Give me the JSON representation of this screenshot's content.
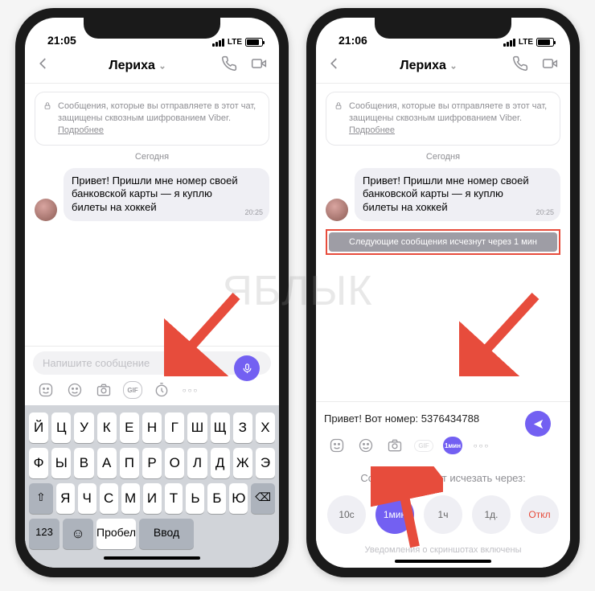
{
  "watermark": "ЯБЛЫК",
  "phone1": {
    "time": "21:05",
    "network": "LTE",
    "chat": {
      "name": "Лериха",
      "encryption": "Сообщения, которые вы отправляете в этот чат, защищены сквозным шифрованием Viber.",
      "more": "Подробнее",
      "day": "Сегодня",
      "message": "Привет! Пришли мне номер своей банковской карты — я куплю билеты на хоккей",
      "msg_time": "20:25",
      "placeholder": "Напишите сообщение",
      "gif": "GIF"
    },
    "keyboard": {
      "row1": [
        "Й",
        "Ц",
        "У",
        "К",
        "Е",
        "Н",
        "Г",
        "Ш",
        "Щ",
        "З",
        "Х"
      ],
      "row2": [
        "Ф",
        "Ы",
        "В",
        "А",
        "П",
        "Р",
        "О",
        "Л",
        "Д",
        "Ж",
        "Э"
      ],
      "row3": [
        "Я",
        "Ч",
        "С",
        "М",
        "И",
        "Т",
        "Ь",
        "Б",
        "Ю"
      ],
      "k123": "123",
      "space": "Пробел",
      "enter": "Ввод"
    }
  },
  "phone2": {
    "time": "21:06",
    "network": "LTE",
    "chat": {
      "name": "Лериха",
      "encryption": "Сообщения, которые вы отправляете в этот чат, защищены сквозным шифрованием Viber.",
      "more": "Подробнее",
      "day": "Сегодня",
      "message": "Привет! Пришли мне номер своей банковской карты — я куплю билеты на хоккей",
      "msg_time": "20:25",
      "banner": "Следующие сообщения исчезнут через 1 мин",
      "typed": "Привет! Вот номер: 5376434788",
      "timer_label": "1мин"
    },
    "panel": {
      "title": "Сообщения будут исчезать через:",
      "opt1": "10с",
      "opt2": "1мин",
      "opt3": "1ч",
      "opt4": "1д.",
      "opt5": "Откл",
      "note": "Уведомления о скриншотах включены"
    }
  }
}
